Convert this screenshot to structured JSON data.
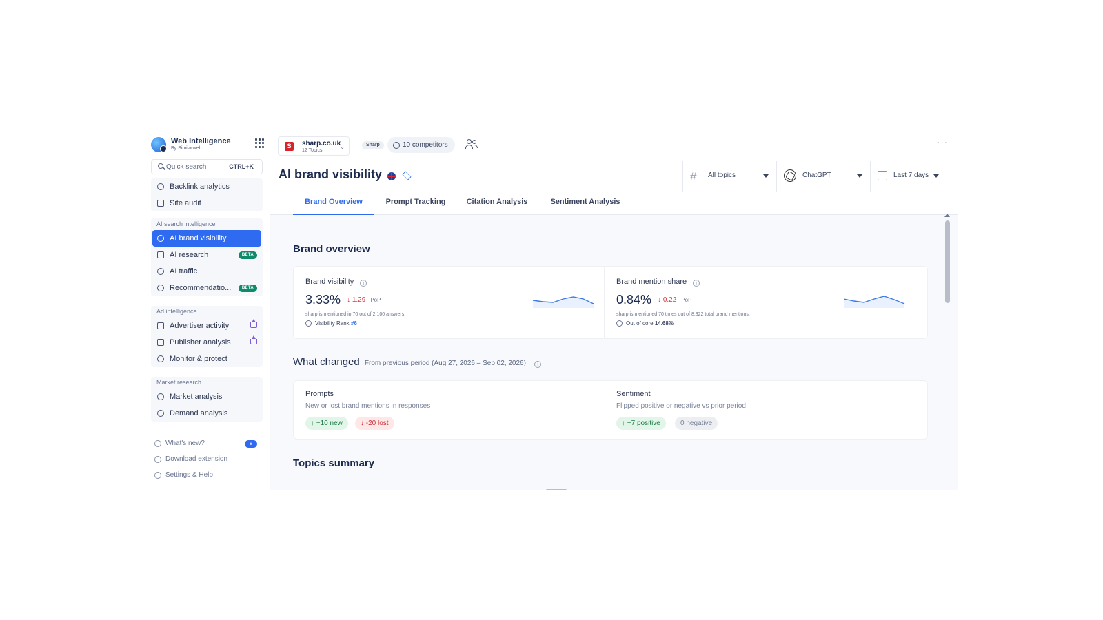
{
  "app": {
    "name": "Web Intelligence",
    "by": "By Similarweb"
  },
  "search": {
    "placeholder": "Quick search",
    "shortcut": "CTRL+K"
  },
  "sidebar": {
    "top_items": [
      {
        "label": "Backlink analytics",
        "icon": "link-icon"
      },
      {
        "label": "Site audit",
        "icon": "audit-icon"
      }
    ],
    "groups": [
      {
        "header": "AI search intelligence",
        "items": [
          {
            "label": "AI brand visibility",
            "icon": "eye-icon",
            "active": true
          },
          {
            "label": "AI research",
            "icon": "research-icon",
            "badge": "BETA"
          },
          {
            "label": "AI traffic",
            "icon": "sparkle-icon"
          },
          {
            "label": "Recommendatio...",
            "icon": "bulb-icon",
            "badge": "BETA"
          }
        ]
      },
      {
        "header": "Ad intelligence",
        "items": [
          {
            "label": "Advertiser activity",
            "icon": "advertiser-icon",
            "premium": true
          },
          {
            "label": "Publisher analysis",
            "icon": "megaphone-icon",
            "premium": true
          },
          {
            "label": "Monitor & protect",
            "icon": "monitor-icon"
          }
        ]
      },
      {
        "header": "Market research",
        "items": [
          {
            "label": "Market analysis",
            "icon": "market-icon"
          },
          {
            "label": "Demand analysis",
            "icon": "demand-icon"
          }
        ]
      }
    ],
    "footer": [
      {
        "label": "What's new?",
        "icon": "rocket-icon",
        "count": "8"
      },
      {
        "label": "Download extension",
        "icon": "puzzle-icon"
      },
      {
        "label": "Settings & Help",
        "icon": "gear-icon"
      }
    ]
  },
  "topbar": {
    "site": "sharp.co.uk",
    "topics": "12 Topics",
    "site_logo": "S",
    "brand_chip": "Sharp",
    "competitors": "10 competitors",
    "more": "···"
  },
  "header": {
    "title": "AI brand visibility",
    "filters": {
      "topics": "All topics",
      "engine": "ChatGPT",
      "period": "Last 7 days"
    }
  },
  "tabs": [
    {
      "label": "Brand Overview",
      "active": true
    },
    {
      "label": "Prompt Tracking"
    },
    {
      "label": "Citation Analysis"
    },
    {
      "label": "Sentiment Analysis"
    }
  ],
  "brand_overview": {
    "title": "Brand overview",
    "visibility": {
      "label": "Brand visibility",
      "value": "3.33%",
      "delta": "↓ 1.29",
      "delta_unit": "PoP",
      "note": "sharp is mentioned in 70 out of 2,100 answers.",
      "rank_label": "Visibility Rank",
      "rank_value": "#6",
      "trend": [
        0.45,
        0.35,
        0.3,
        0.55,
        0.7,
        0.55,
        0.2
      ]
    },
    "mention_share": {
      "label": "Brand mention share",
      "value": "0.84%",
      "delta": "↓ 0.22",
      "delta_unit": "PoP",
      "note": "sharp is mentioned 70 times out of 8,322 total brand mentions.",
      "rank_label": "Out of core",
      "rank_value": "14.68%",
      "trend": [
        0.55,
        0.4,
        0.3,
        0.55,
        0.75,
        0.5,
        0.2
      ]
    }
  },
  "what_changed": {
    "title": "What changed",
    "subtitle": "From previous period (Aug 27, 2026 – Sep 02, 2026)",
    "prompts": {
      "title": "Prompts",
      "desc": "New or lost brand mentions in responses",
      "new": "↑ +10 new",
      "lost": "↓ -20 lost"
    },
    "sentiment": {
      "title": "Sentiment",
      "desc": "Flipped positive or negative vs prior period",
      "positive": "↑ +7 positive",
      "negative": "0 negative"
    }
  },
  "topics_summary": {
    "title": "Topics summary"
  },
  "colors": {
    "accent": "#2f6bf0",
    "negative": "#d9363e",
    "positive": "#1d7a45",
    "beta": "#0f8a6a",
    "premium": "#7f5cd6"
  }
}
